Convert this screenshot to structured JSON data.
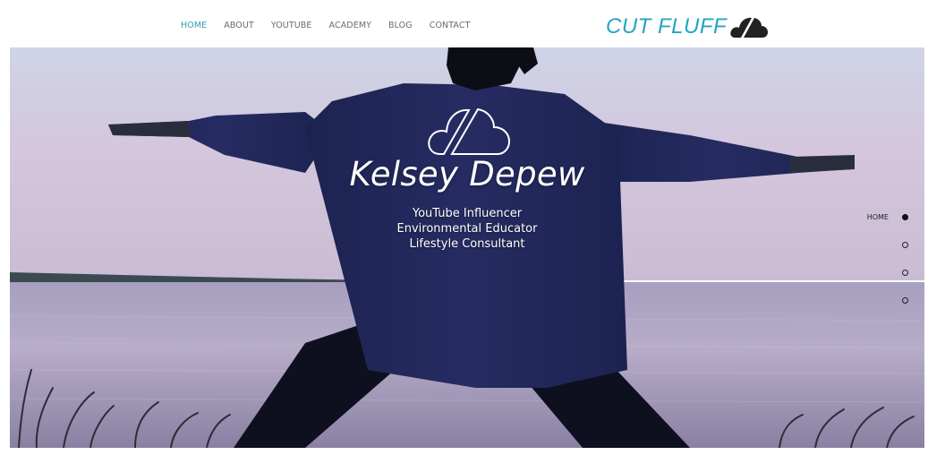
{
  "nav": {
    "items": [
      {
        "label": "HOME",
        "active": true
      },
      {
        "label": "ABOUT",
        "active": false
      },
      {
        "label": "YOUTUBE",
        "active": false
      },
      {
        "label": "ACADEMY",
        "active": false
      },
      {
        "label": "BLOG",
        "active": false
      },
      {
        "label": "CONTACT",
        "active": false
      }
    ],
    "active_color": "#2f9fb0",
    "text_color": "#6b6b6b"
  },
  "logo": {
    "text": "CUT FLUFF",
    "icon": "cloud-icon",
    "color": "#23a5c2"
  },
  "hero": {
    "icon": "cloud-outline-icon",
    "name": "Kelsey Depew",
    "taglines": [
      "YouTube Influencer",
      "Environmental Educator",
      "Lifestyle Consultant"
    ]
  },
  "dot_nav": {
    "items": [
      {
        "label": "HOME",
        "active": true
      },
      {
        "label": "",
        "active": false
      },
      {
        "label": "",
        "active": false
      },
      {
        "label": "",
        "active": false
      }
    ]
  }
}
